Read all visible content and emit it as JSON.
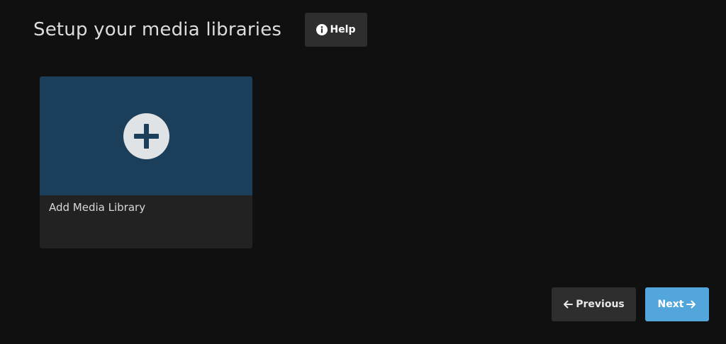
{
  "header": {
    "title": "Setup your media libraries",
    "help_label": "Help",
    "help_icon": "info-circle-icon"
  },
  "library_cards": [
    {
      "label": "Add Media Library",
      "icon": "plus-circle-icon"
    }
  ],
  "footer": {
    "previous_label": "Previous",
    "previous_icon": "arrow-left-icon",
    "next_label": "Next",
    "next_icon": "arrow-right-icon"
  },
  "colors": {
    "background": "#101010",
    "card_image": "#1b3f5a",
    "card_body": "#222222",
    "secondary_button": "#2e2e2e",
    "accent_button": "#53a6dc"
  }
}
